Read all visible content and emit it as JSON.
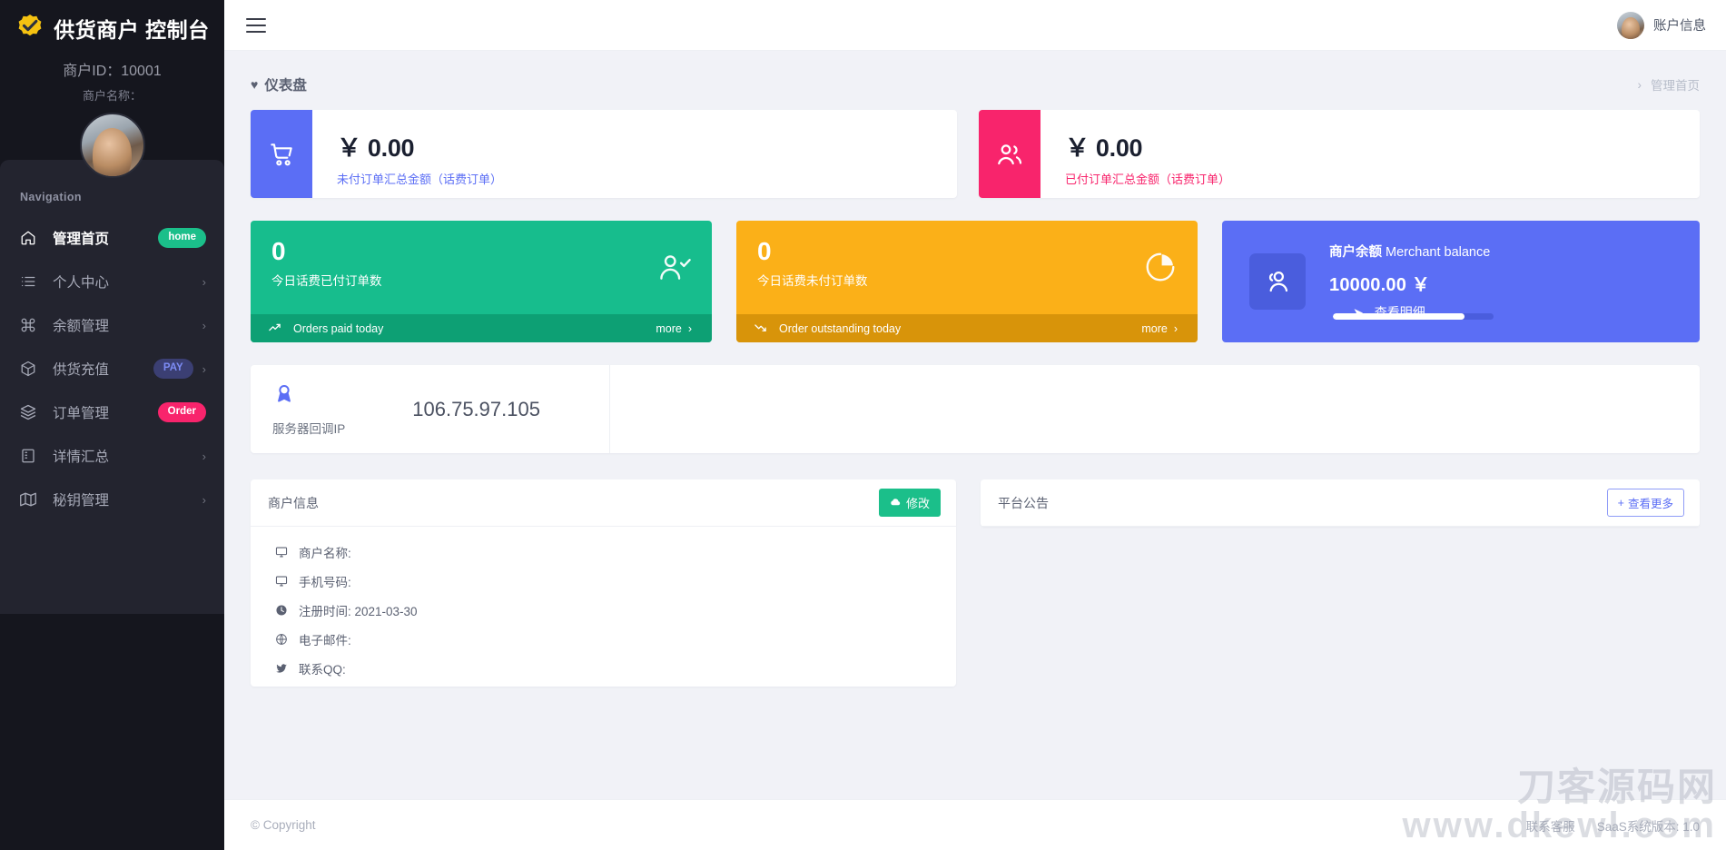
{
  "sidebar": {
    "brand_title": "供货商户 控制台",
    "logo_icon": "check-badge-icon",
    "merchant_id": "商户ID：10001",
    "merchant_name": "商户名称：",
    "nav_heading": "Navigation",
    "items": [
      {
        "label": "管理首页",
        "icon": "home-icon",
        "badge": "home",
        "badge_type": "home",
        "has_chevron": false,
        "active": true
      },
      {
        "label": "个人中心",
        "icon": "list-icon",
        "badge": "",
        "badge_type": "",
        "has_chevron": true,
        "active": false
      },
      {
        "label": "余额管理",
        "icon": "command-icon",
        "badge": "",
        "badge_type": "",
        "has_chevron": true,
        "active": false
      },
      {
        "label": "供货充值",
        "icon": "box-icon",
        "badge": "PAY",
        "badge_type": "pay",
        "has_chevron": true,
        "active": false
      },
      {
        "label": "订单管理",
        "icon": "layers-icon",
        "badge": "Order",
        "badge_type": "order",
        "has_chevron": false,
        "active": false
      },
      {
        "label": "详情汇总",
        "icon": "book-icon",
        "badge": "",
        "badge_type": "",
        "has_chevron": true,
        "active": false
      },
      {
        "label": "秘钥管理",
        "icon": "map-icon",
        "badge": "",
        "badge_type": "",
        "has_chevron": true,
        "active": false
      }
    ]
  },
  "topbar": {
    "menu_icon": "hamburger-icon",
    "account_label": "账户信息",
    "account_avatar": "user-avatar"
  },
  "page": {
    "title": "仪表盘",
    "title_icon": "heart-icon",
    "breadcrumb_sep": "›",
    "breadcrumb_current": "管理首页"
  },
  "money_cards": [
    {
      "icon": "cart-icon",
      "value": "￥ 0.00",
      "label": "未付订单汇总金额（话费订单）",
      "color": "#5b6ef5"
    },
    {
      "icon": "users-icon",
      "value": "￥ 0.00",
      "label": "已付订单汇总金额（话费订单）",
      "color": "#f8246c"
    }
  ],
  "stat_cards": [
    {
      "number": "0",
      "subtitle": "今日话费已付订单数",
      "big_icon": "user-check-icon",
      "foot_icon": "trend-up-icon",
      "foot_label": "Orders paid today",
      "more_label": "more",
      "more_chevron": "›",
      "color": "#17bd8d",
      "foot_color": "#0da074"
    },
    {
      "number": "0",
      "subtitle": "今日话费未付订单数",
      "big_icon": "pie-chart-icon",
      "foot_icon": "trend-down-icon",
      "foot_label": "Order outstanding today",
      "more_label": "more",
      "more_chevron": "›",
      "color": "#fbb018",
      "foot_color": "#d8940a"
    }
  ],
  "balance_card": {
    "icon": "users-group-icon",
    "title_cn": "商户余额",
    "title_en": " Merchant balance",
    "amount": "10000.00 ￥",
    "link_icon": "send-icon",
    "link_label": "查看明细",
    "progress_percent": 82,
    "color": "#5b6ef5"
  },
  "ip_card": {
    "icon": "award-icon",
    "caption": "服务器回调IP",
    "value": "106.75.97.105"
  },
  "merchant_panel": {
    "title": "商户信息",
    "edit_icon": "cloud-icon",
    "edit_label": "修改",
    "rows": [
      {
        "icon": "monitor-icon",
        "text": "商户名称:"
      },
      {
        "icon": "monitor-icon",
        "text": "手机号码:"
      },
      {
        "icon": "clock-icon",
        "text": "注册时间: 2021-03-30"
      },
      {
        "icon": "globe-icon",
        "text": "电子邮件:"
      },
      {
        "icon": "twitter-icon",
        "text": "联系QQ:"
      }
    ]
  },
  "notice_panel": {
    "title": "平台公告",
    "more_icon": "plus-icon",
    "more_label": "查看更多"
  },
  "footer": {
    "copyright": "© Copyright",
    "support_label": "联系客服",
    "version_label": "SaaS系统版本: 1.0"
  },
  "watermark": {
    "line1": "刀客源码网",
    "line2": "www.dkewl.com"
  }
}
